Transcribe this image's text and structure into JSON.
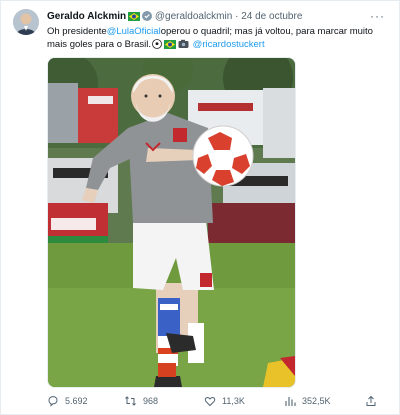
{
  "author": {
    "name": "Geraldo Alckmin",
    "handle": "@geraldoalckmin",
    "separator": "·",
    "date": "24 de octubre"
  },
  "more_label": "···",
  "tweet": {
    "part1": "Oh presidente",
    "mention1": "@LulaOficial",
    "part2": "operou o quadril; mas já voltou, para marcar muito mais goles para o Brasil.",
    "mention2": "@ricardostuckert"
  },
  "actions": {
    "replies": "5.692",
    "retweets": "968",
    "likes": "11,3K",
    "views": "352,5K"
  },
  "colors": {
    "accent": "#1d9bf0",
    "text": "#0f1419",
    "muted": "#536471"
  },
  "icons": [
    "more-icon",
    "verified-icon",
    "brazil-flag-icon",
    "soccer-ball-icon",
    "camera-icon",
    "reply-icon",
    "retweet-icon",
    "like-icon",
    "views-icon",
    "share-icon"
  ]
}
